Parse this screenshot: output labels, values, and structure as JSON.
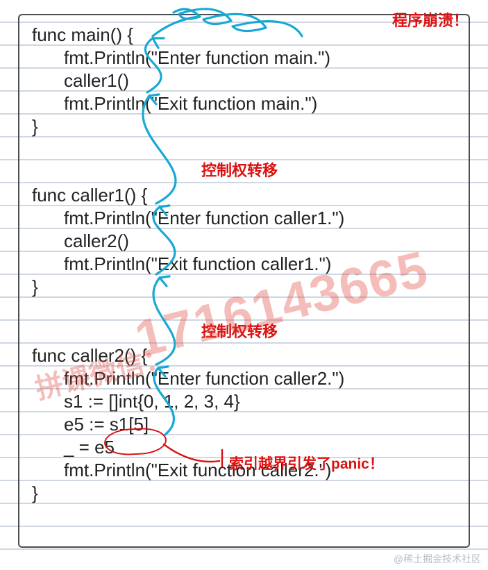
{
  "code": {
    "main": [
      "func main() {",
      "fmt.Println(\"Enter function main.\")",
      "caller1()",
      "fmt.Println(\"Exit function main.\")",
      "}"
    ],
    "caller1": [
      "func caller1() {",
      "fmt.Println(\"Enter function caller1.\")",
      "caller2()",
      "fmt.Println(\"Exit function caller1.\")",
      "}"
    ],
    "caller2": [
      "func caller2() {",
      "fmt.Println(\"Enter function caller2.\")",
      "s1 := []int{0, 1, 2, 3, 4}",
      "e5 := s1[5]",
      "_ = e5",
      "fmt.Println(\"Exit function caller2.\")",
      "}"
    ]
  },
  "annotations": {
    "crash": "程序崩溃！",
    "transfer": "控制权转移",
    "panic": "索引越界引发了panic！"
  },
  "watermark": {
    "big": "1716143665",
    "small": "拼课微信："
  },
  "footer": "@稀土掘金技术社区",
  "colors": {
    "ink": "#222222",
    "annotation": "#dd1111",
    "arrow": "#17a8d6",
    "border": "#4a4e52"
  }
}
